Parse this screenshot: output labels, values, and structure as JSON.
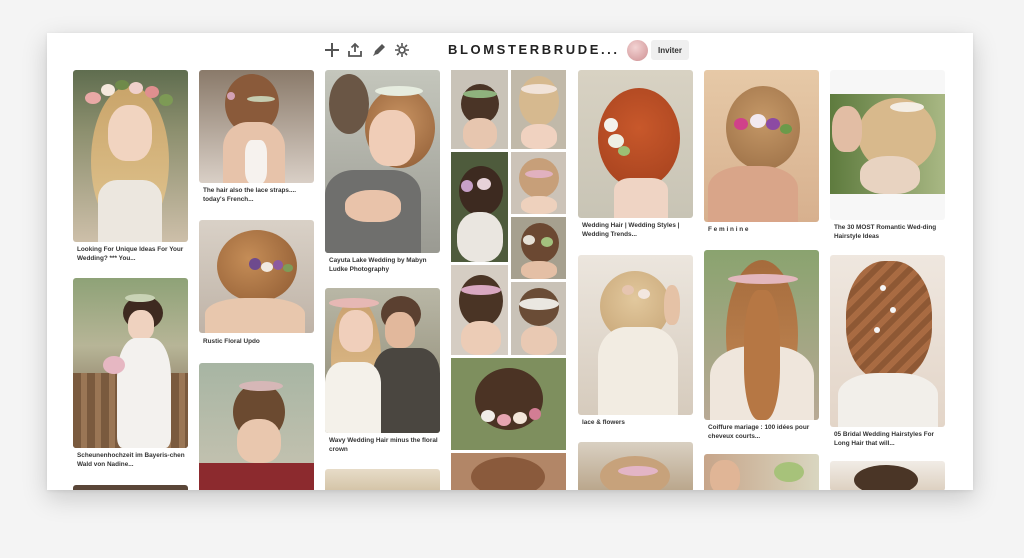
{
  "toolbar": {
    "icons": [
      "plus-icon",
      "share-icon",
      "edit-icon",
      "organize-icon"
    ],
    "board_title": "BLOMSTERBRUDE...",
    "avatar_text": "",
    "invite_label": "Inviter"
  },
  "pins": {
    "c1p1": "Looking For Unique Ideas For Your Wedding? *** You...",
    "c1p2": "Scheunenhochzeit im Bayeris-chen Wald von Nadine...",
    "c2p1": "The hair also the lace straps.... today's French...",
    "c2p2": "Rustic Floral Updo",
    "c3p1": "Cayuta Lake Wedding by Mabyn Ludke Photography",
    "c3p2": "Wavy Wedding Hair minus the floral crown",
    "c5p1": "Wedding Hair | Wedding Styles | Wedding Trends...",
    "c5p2": "lace & flowers",
    "c6p1": "F e m i n i n e",
    "c6p2": "Coiffure mariage : 100 idées pour cheveux courts...",
    "c7p1": "The 30 MOST Romantic Wed-ding Hairstyle Ideas",
    "c7p2": "05 Bridal Wedding Hairstyles For Long Hair that will..."
  },
  "colors": {
    "page_bg": "#f4f4f4",
    "frame_bg": "#ffffff",
    "text": "#333333",
    "title": "#222222",
    "button_bg": "#efefef"
  }
}
